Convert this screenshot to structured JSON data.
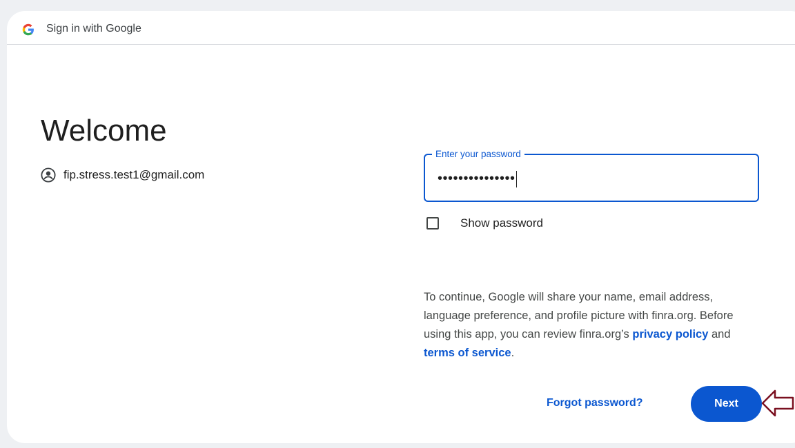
{
  "header": {
    "title": "Sign in with Google",
    "logo_icon": "google-g-logo"
  },
  "main": {
    "heading": "Welcome",
    "account": {
      "icon": "account-circle-icon",
      "email": "fip.stress.test1@gmail.com"
    }
  },
  "password": {
    "label": "Enter your password",
    "masked_value": "•••••••••••••••",
    "show_label": "Show password",
    "show_checked": false
  },
  "consent": {
    "line1": "To continue, Google will share your name, email address, language preference, and profile picture with finra.org. Before using this app, you can review finra.org’s ",
    "privacy_link": "privacy policy",
    "and_text": " and ",
    "terms_link": "terms of service",
    "end": "."
  },
  "actions": {
    "forgot_label": "Forgot password?",
    "next_label": "Next"
  },
  "colors": {
    "accent": "#0b57d0",
    "annotation_arrow": "#7a1020"
  }
}
